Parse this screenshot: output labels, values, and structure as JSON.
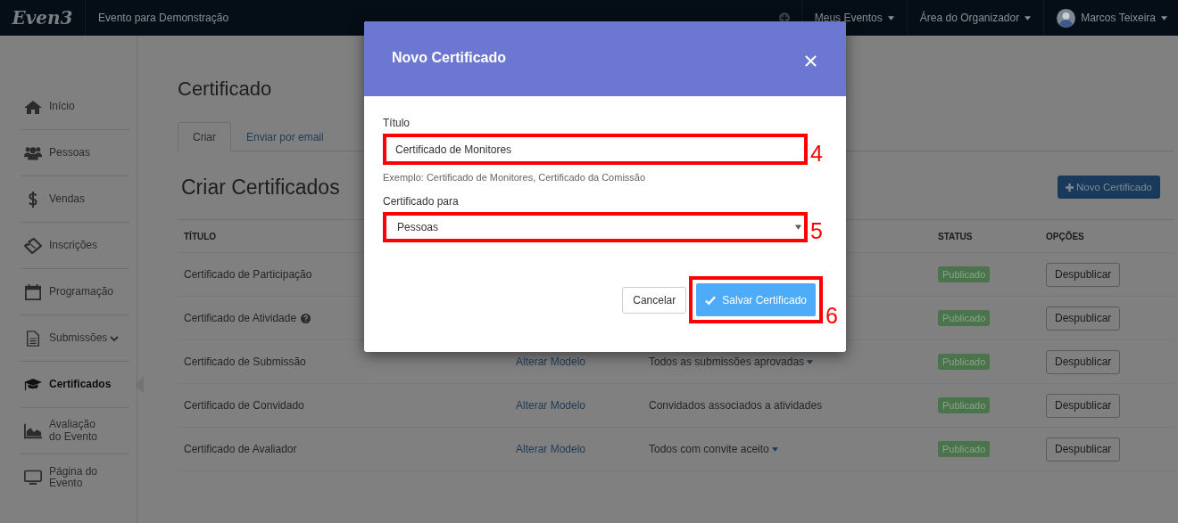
{
  "topbar": {
    "logo": "Even3",
    "event": "Evento para Demonstração",
    "menus": [
      {
        "label": "Meus Eventos"
      },
      {
        "label": "Área do Organizador"
      }
    ],
    "user": {
      "name": "Marcos Teixeira"
    }
  },
  "sidebar": {
    "items": [
      {
        "label": "Início",
        "selected": false
      },
      {
        "label": "Pessoas",
        "selected": false
      },
      {
        "label": "Vendas",
        "selected": false
      },
      {
        "label": "Inscrições",
        "selected": false
      },
      {
        "label": "Programação",
        "selected": false
      },
      {
        "label": "Submissões",
        "selected": false,
        "expanded": false
      },
      {
        "label": "Certificados",
        "selected": true
      },
      {
        "label": "Avaliação do Evento",
        "selected": false
      },
      {
        "label": "Página do Evento",
        "selected": false
      }
    ]
  },
  "page": {
    "title": "Certificado",
    "tabs": [
      {
        "label": "Criar",
        "selected": true
      },
      {
        "label": "Enviar por email",
        "selected": false
      }
    ],
    "section_title": "Criar Certificados",
    "new_button": "Novo Certificado",
    "table": {
      "columns": {
        "title": "TÍTULO",
        "status": "STATUS",
        "options": "OPÇÕES"
      },
      "rows": [
        {
          "title": "Certificado de Participação",
          "help": false,
          "status": "Publicado",
          "action": "Despublicar"
        },
        {
          "title": "Certificado de Atividade",
          "help": true,
          "status": "Publicado",
          "action": "Despublicar"
        },
        {
          "title": "Certificado de Submissão",
          "help": false,
          "model_link": "Alterar Modelo",
          "recipients": "Todos as submissões aprovadas",
          "dropdown": true,
          "status": "Publicado",
          "action": "Despublicar"
        },
        {
          "title": "Certificado de Convidado",
          "help": false,
          "model_link": "Alterar Modelo",
          "recipients": "Convidados associados a atividades",
          "dropdown": false,
          "status": "Publicado",
          "action": "Despublicar"
        },
        {
          "title": "Certificado de Avaliador",
          "help": false,
          "model_link": "Alterar Modelo",
          "recipients": "Todos com convite aceito",
          "dropdown": true,
          "status": "Publicado",
          "action": "Despublicar"
        }
      ]
    }
  },
  "modal": {
    "title": "Novo Certificado",
    "title_field": {
      "label": "Título",
      "value": "Certificado de Monitores",
      "hint": "Exemplo: Certificado de Monitores, Certificado da Comissão",
      "marker": "4"
    },
    "for_field": {
      "label": "Certificado para",
      "value": "Pessoas",
      "marker": "5"
    },
    "cancel": "Cancelar",
    "save": {
      "label": "Salvar Certificado",
      "marker": "6"
    }
  }
}
